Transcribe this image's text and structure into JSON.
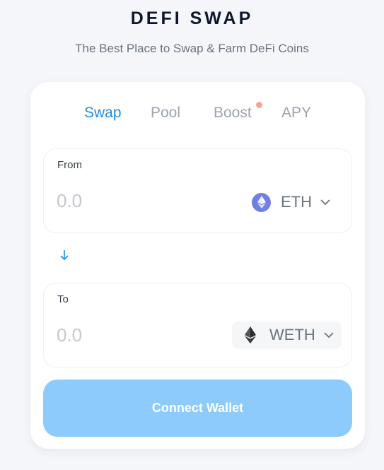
{
  "header": {
    "title": "DEFI SWAP",
    "subtitle": "The Best Place to Swap & Farm DeFi Coins"
  },
  "tabs": [
    {
      "label": "Swap",
      "active": true
    },
    {
      "label": "Pool",
      "active": false
    },
    {
      "label": "Boost",
      "active": false,
      "has_notification_dot": true
    },
    {
      "label": "APY",
      "active": false
    }
  ],
  "from": {
    "label": "From",
    "amount_value": "",
    "amount_placeholder": "0.0",
    "token": {
      "symbol": "ETH",
      "icon": "ethereum-icon"
    }
  },
  "switch_icon": "arrow-down-icon",
  "to": {
    "label": "To",
    "amount_value": "",
    "amount_placeholder": "0.0",
    "token": {
      "symbol": "WETH",
      "icon": "ethereum-icon"
    }
  },
  "connect_button": {
    "label": "Connect Wallet"
  },
  "colors": {
    "accent": "#1d8fe1",
    "button": "#8ccbfb",
    "notification_dot": "#f5a492",
    "eth_blue": "#6f7fe6"
  }
}
